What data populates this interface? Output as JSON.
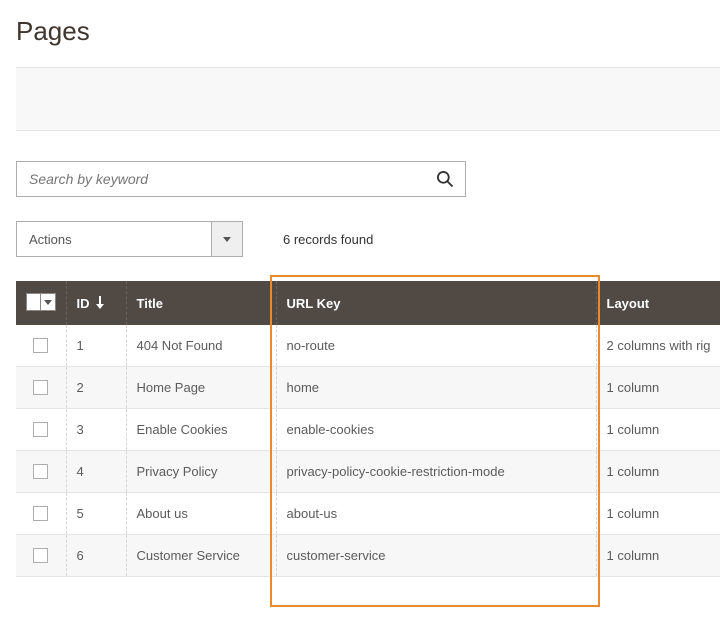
{
  "page": {
    "title": "Pages"
  },
  "search": {
    "placeholder": "Search by keyword"
  },
  "actions": {
    "label": "Actions"
  },
  "summary": {
    "records_found": "6 records found"
  },
  "table": {
    "headers": {
      "id": "ID",
      "title": "Title",
      "url_key": "URL Key",
      "layout": "Layout"
    },
    "rows": [
      {
        "id": "1",
        "title": "404 Not Found",
        "url_key": "no-route",
        "layout": "2 columns with rig"
      },
      {
        "id": "2",
        "title": "Home Page",
        "url_key": "home",
        "layout": "1 column"
      },
      {
        "id": "3",
        "title": "Enable Cookies",
        "url_key": "enable-cookies",
        "layout": "1 column"
      },
      {
        "id": "4",
        "title": "Privacy Policy",
        "url_key": "privacy-policy-cookie-restriction-mode",
        "layout": "1 column"
      },
      {
        "id": "5",
        "title": "About us",
        "url_key": "about-us",
        "layout": "1 column"
      },
      {
        "id": "6",
        "title": "Customer Service",
        "url_key": "customer-service",
        "layout": "1 column"
      }
    ]
  }
}
